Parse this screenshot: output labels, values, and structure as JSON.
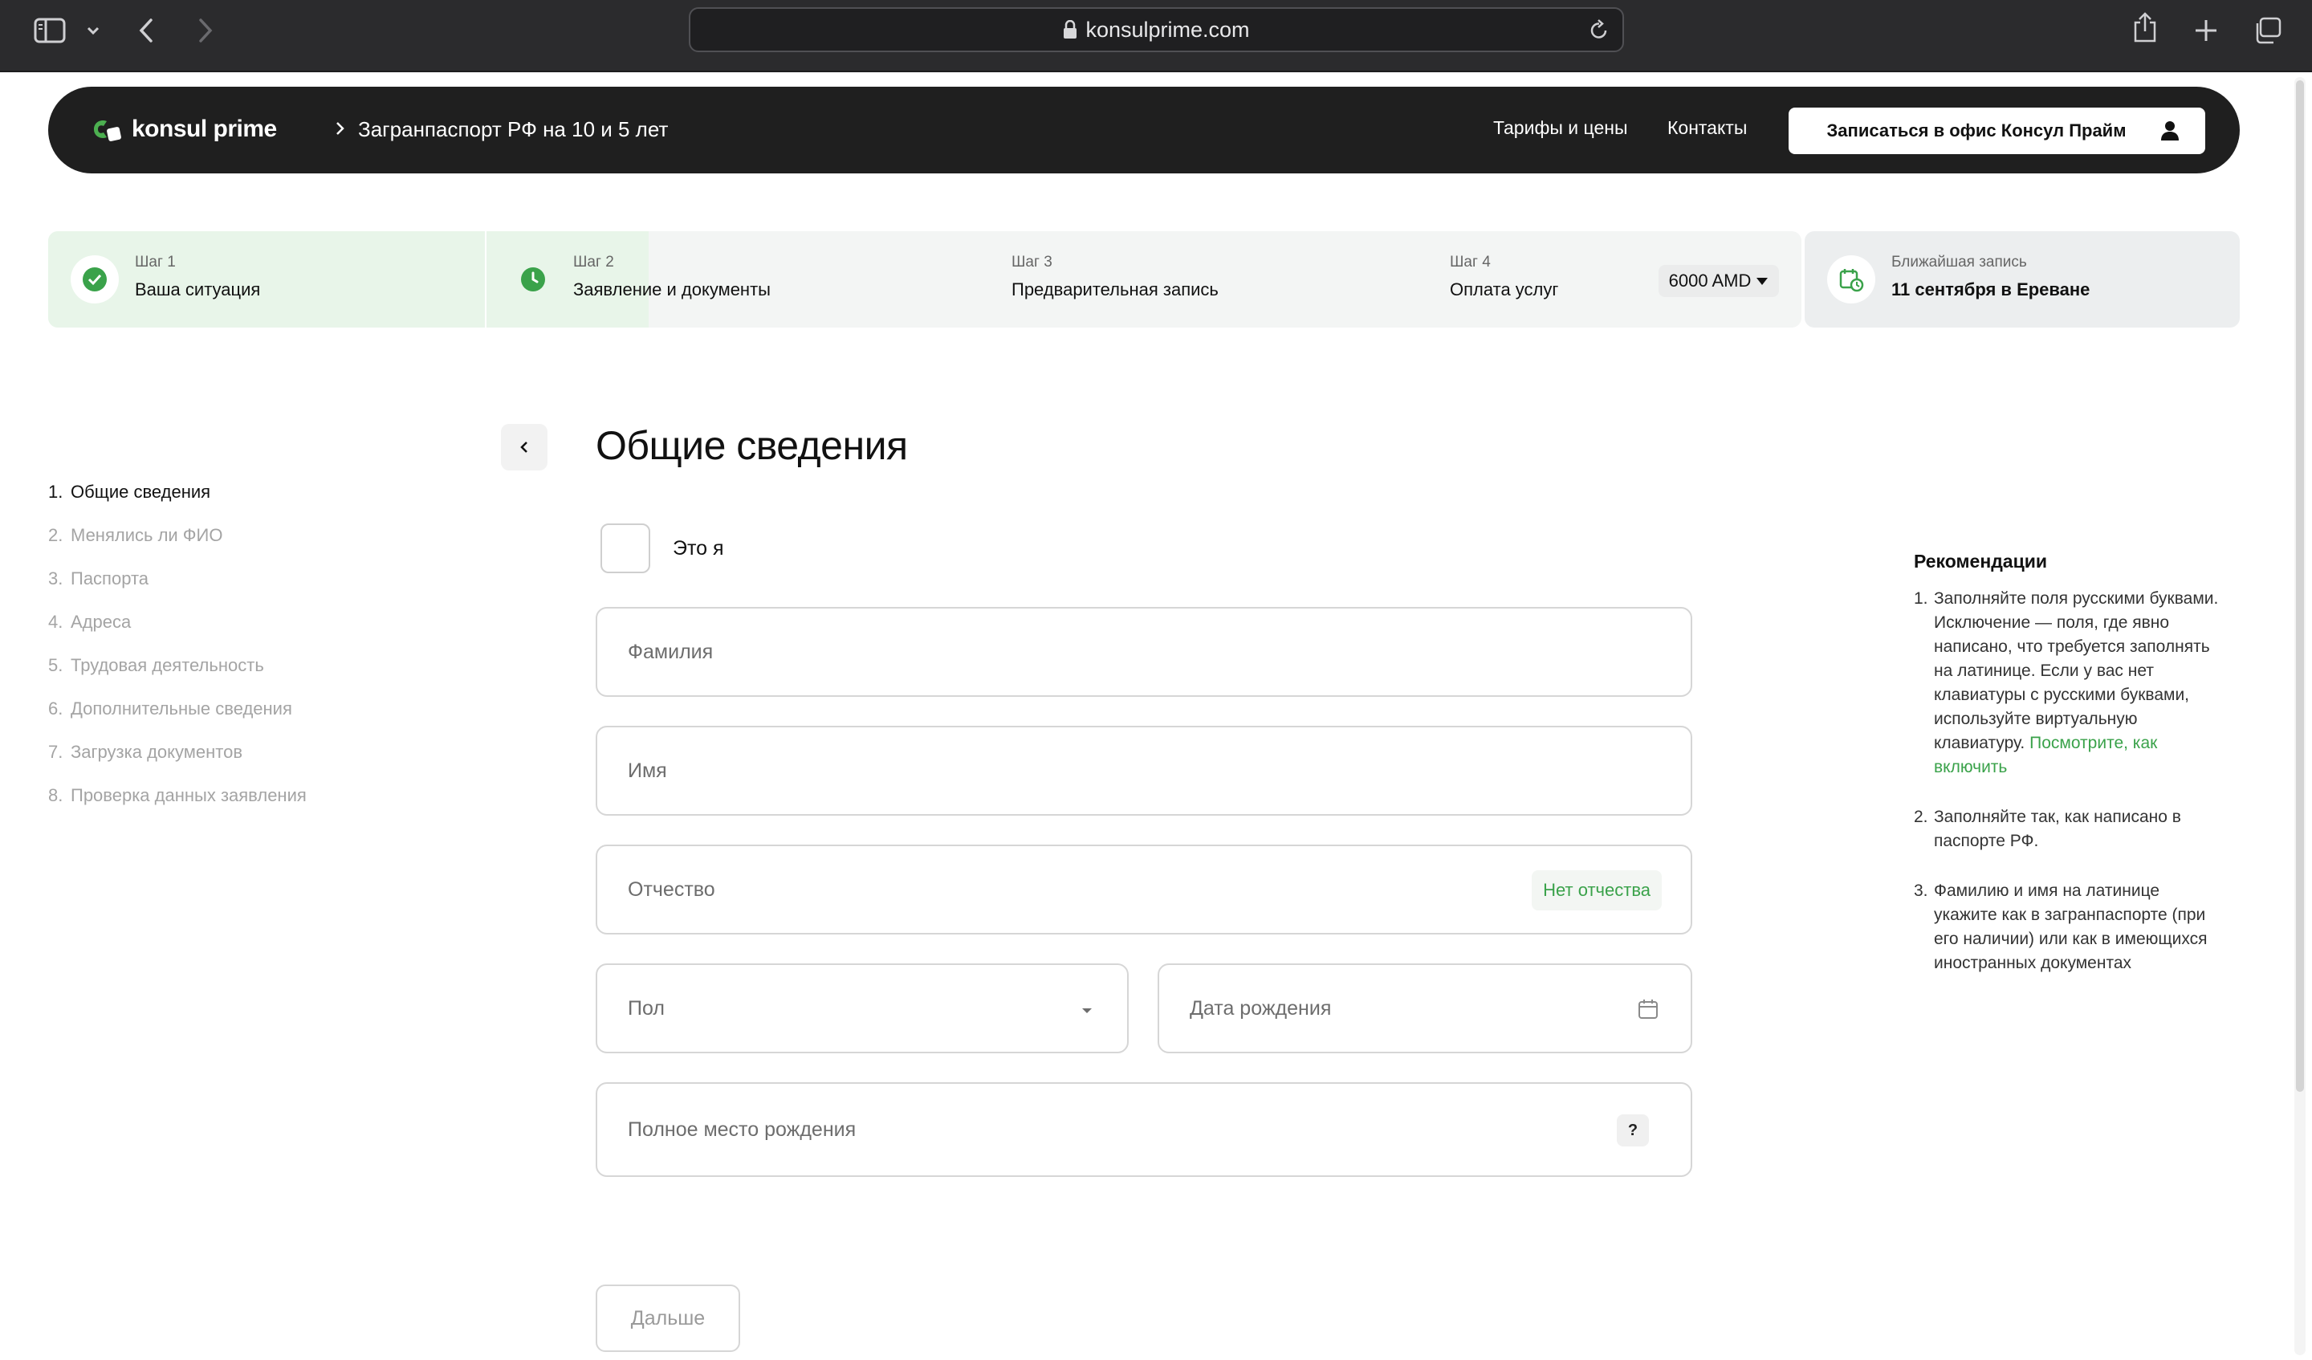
{
  "browser": {
    "url": "konsulprime.com"
  },
  "header": {
    "logo_text": "konsul prime",
    "breadcrumb": "Загранпаспорт РФ на 10 и 5 лет",
    "nav": [
      "Тарифы и цены",
      "Контакты"
    ],
    "cta_label": "Записаться в офис Консул Прайм"
  },
  "steps": [
    {
      "label": "Шаг 1",
      "title": "Ваша ситуация",
      "status": "done"
    },
    {
      "label": "Шаг 2",
      "title": "Заявление и документы",
      "status": "in-progress"
    },
    {
      "label": "Шаг 3",
      "title": "Предварительная запись",
      "status": "pending"
    },
    {
      "label": "Шаг 4",
      "title": "Оплата услуг",
      "status": "pending"
    }
  ],
  "price": "6000 AMD",
  "next_slot": {
    "label": "Ближайшая запись",
    "value": "11 сентября в Ереване"
  },
  "sidemenu": [
    {
      "num": "1.",
      "label": "Общие сведения"
    },
    {
      "num": "2.",
      "label": "Менялись ли ФИО"
    },
    {
      "num": "3.",
      "label": "Паспорта"
    },
    {
      "num": "4.",
      "label": "Адреса"
    },
    {
      "num": "5.",
      "label": "Трудовая деятельность"
    },
    {
      "num": "6.",
      "label": "Дополнительные сведения"
    },
    {
      "num": "7.",
      "label": "Загрузка документов"
    },
    {
      "num": "8.",
      "label": "Проверка данных заявления"
    }
  ],
  "form": {
    "title": "Общие сведения",
    "checkbox_label": "Это я",
    "last_name": "Фамилия",
    "first_name": "Имя",
    "patronymic": "Отчество",
    "no_patronymic": "Нет отчества",
    "gender": "Пол",
    "birth_date": "Дата рождения",
    "birth_place": "Полное место рождения",
    "help": "?",
    "next_label": "Дальше"
  },
  "recommendations": {
    "title": "Рекомендации",
    "items": [
      {
        "num": "1.",
        "text": "Заполняйте поля русскими буквами. Исключение — поля, где явно написано, что требуется заполнять на латинице. Если у вас нет клавиатуры с русскими буквами, используйте виртуальную клавиатуру.",
        "link": "Посмотрите, как включить"
      },
      {
        "num": "2.",
        "text": "Заполняйте так, как написано в паспорте РФ."
      },
      {
        "num": "3.",
        "text": "Фамилию и имя на латинице укажите как в загранпаспорте (при его наличии) или как в имеющихся иностранных документах"
      }
    ]
  },
  "colors": {
    "accent_green": "#3aa24a",
    "header_bg": "#1f1f1f",
    "step_done_bg": "#e8f5e9"
  }
}
